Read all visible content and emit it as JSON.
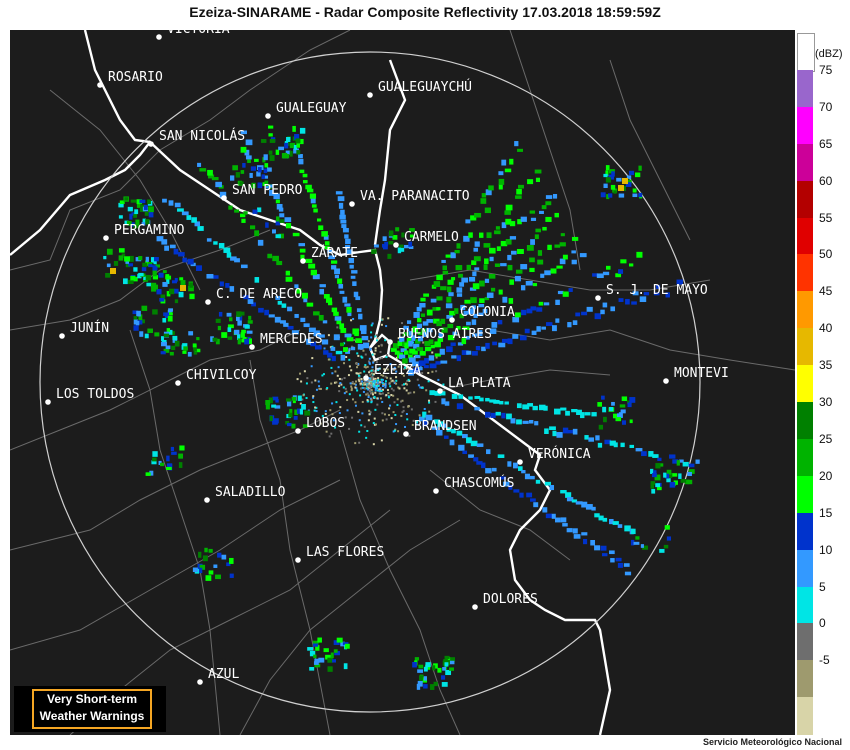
{
  "title": "Ezeiza-SINARAME - Radar Composite Reflectivity 17.03.2018  18:59:59Z",
  "map": {
    "background": "#1c1c1c",
    "radar_site": "EZEIZA",
    "cities": [
      {
        "name": "VICTORIA"
      },
      {
        "name": "ROSARIO"
      },
      {
        "name": "GUALEGUAYCHÚ"
      },
      {
        "name": "GUALEGUAY"
      },
      {
        "name": "SAN NICOLÁS"
      },
      {
        "name": "SAN PEDRO"
      },
      {
        "name": "VA. PARANACITO"
      },
      {
        "name": "PERGAMINO"
      },
      {
        "name": "CARMELO"
      },
      {
        "name": "ZÁRATE"
      },
      {
        "name": "S. J. DE MAYO"
      },
      {
        "name": "C. DE ARECO"
      },
      {
        "name": "COLONIA"
      },
      {
        "name": "JUNÍN"
      },
      {
        "name": "BUENOS AIRES"
      },
      {
        "name": "MERCEDES"
      },
      {
        "name": "EZEIZA"
      },
      {
        "name": "MONTEVI"
      },
      {
        "name": "CHIVILCOY"
      },
      {
        "name": "LA PLATA"
      },
      {
        "name": "LOS TOLDOS"
      },
      {
        "name": "LOBOS"
      },
      {
        "name": "BRANDSEN"
      },
      {
        "name": "VERÓNICA"
      },
      {
        "name": "CHASCOMÚS"
      },
      {
        "name": "SALADILLO"
      },
      {
        "name": "LAS FLORES"
      },
      {
        "name": "DOLORES"
      },
      {
        "name": "AZUL"
      }
    ]
  },
  "scale": {
    "unit": "(dBZ)",
    "bins": [
      {
        "label": "75",
        "color": "#ffffff"
      },
      {
        "label": "70",
        "color": "#9966cc"
      },
      {
        "label": "65",
        "color": "#ff00ff"
      },
      {
        "label": "60",
        "color": "#cc0099"
      },
      {
        "label": "55",
        "color": "#b30000"
      },
      {
        "label": "50",
        "color": "#e00000"
      },
      {
        "label": "45",
        "color": "#ff3300"
      },
      {
        "label": "40",
        "color": "#ff9900"
      },
      {
        "label": "35",
        "color": "#e6b800"
      },
      {
        "label": "30",
        "color": "#ffff00"
      },
      {
        "label": "25",
        "color": "#008000"
      },
      {
        "label": "20",
        "color": "#00b300"
      },
      {
        "label": "15",
        "color": "#00ff00"
      },
      {
        "label": "10",
        "color": "#0033cc"
      },
      {
        "label": "5",
        "color": "#3399ff"
      },
      {
        "label": "0",
        "color": "#00e5e5"
      },
      {
        "label": "-5",
        "color": "#6e6e6e"
      },
      {
        "label": "",
        "color": "#9e9a6e"
      },
      {
        "label": "",
        "color": "#d8d4a8"
      }
    ]
  },
  "warning_box": {
    "line1": "Very Short-term",
    "line2": "Weather Warnings",
    "border_color": "#f5a623"
  },
  "credit": "Servicio Meteorológico Nacional"
}
